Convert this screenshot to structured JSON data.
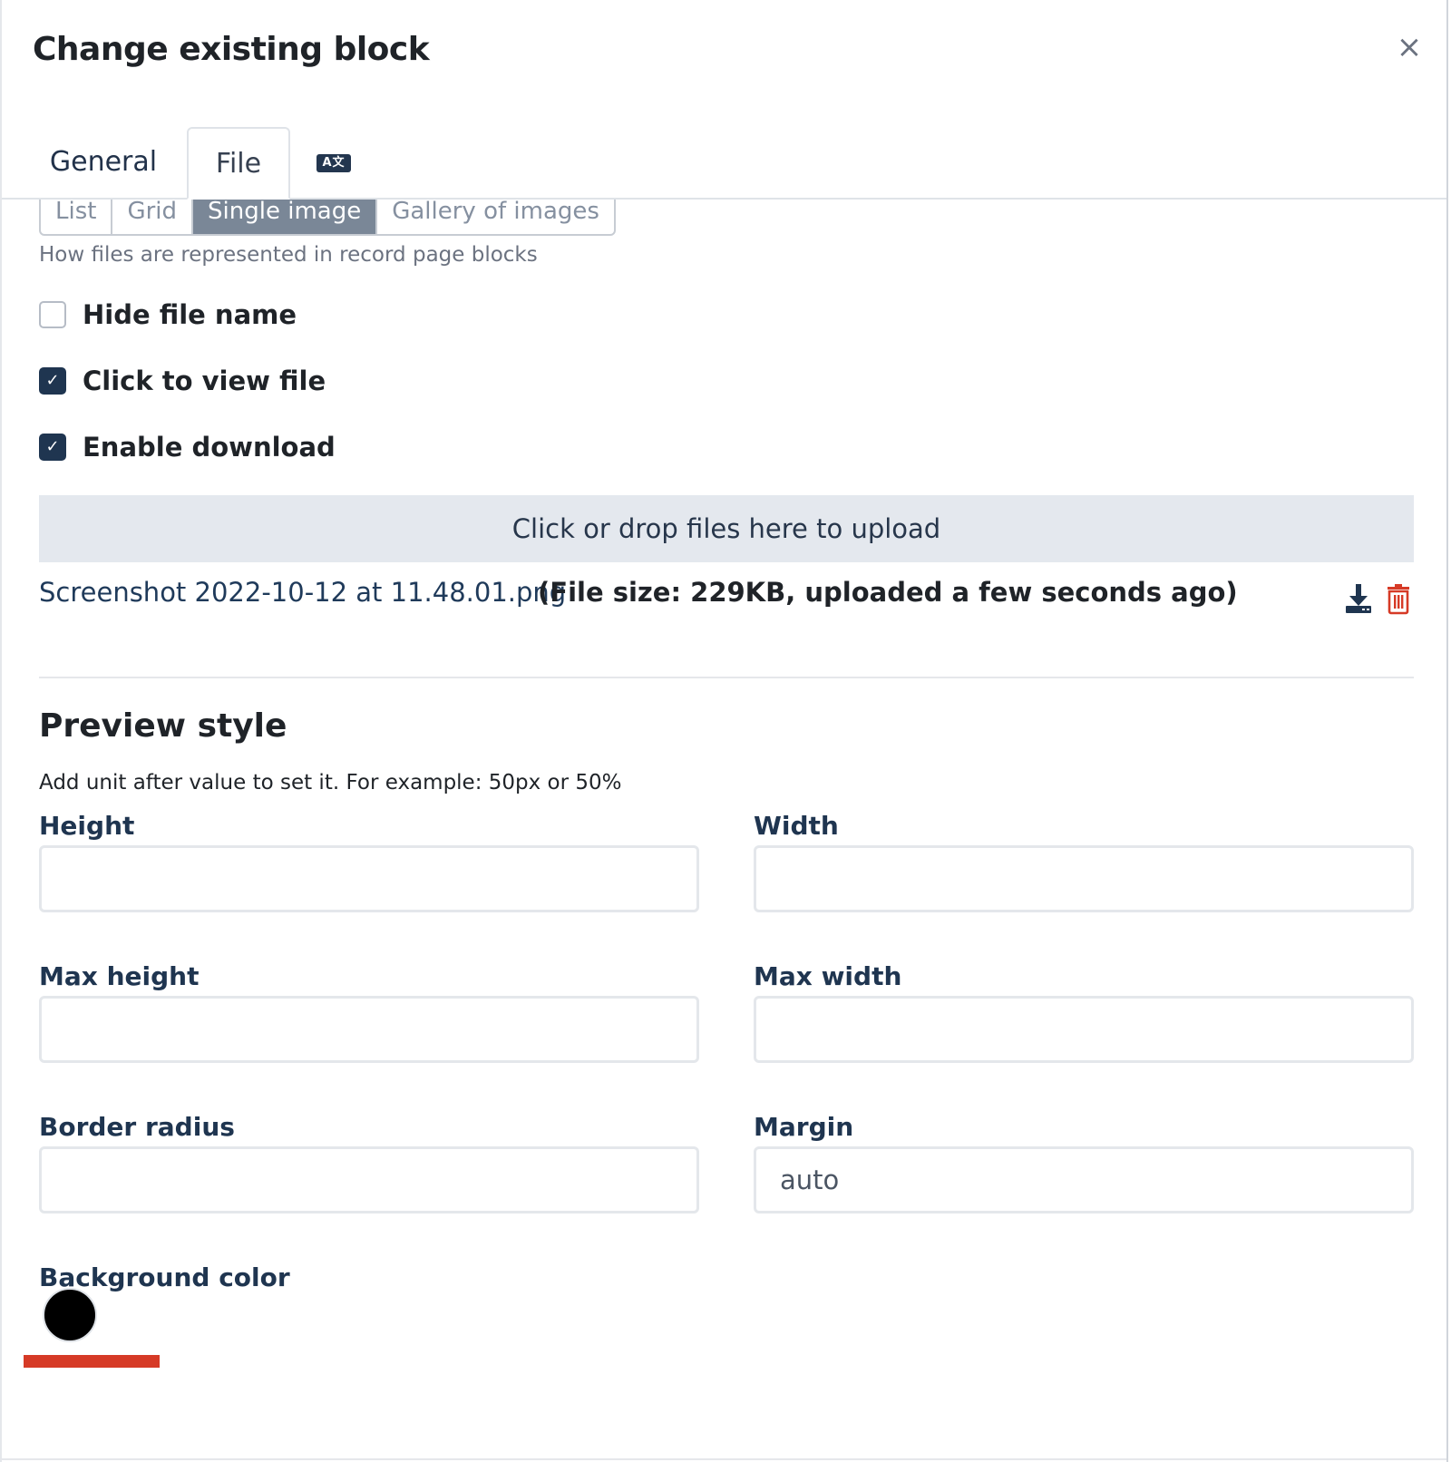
{
  "modal": {
    "title": "Change existing block",
    "close_glyph": "×"
  },
  "tabs": {
    "general": "General",
    "file": "File",
    "translate_icon_text": "A文"
  },
  "representation": {
    "options": [
      "List",
      "Grid",
      "Single image",
      "Gallery of images"
    ],
    "selected": "Single image",
    "helper": "How files are represented in record page blocks"
  },
  "checkboxes": {
    "hide_file_name": {
      "label": "Hide file name",
      "checked": false
    },
    "click_to_view": {
      "label": "Click to view file",
      "checked": true
    },
    "enable_download": {
      "label": "Enable download",
      "checked": true
    }
  },
  "upload": {
    "dropzone_label": "Click or drop files here to upload",
    "file_name": "Screenshot 2022-10-12 at 11.48.01.png",
    "file_meta": "(File size: 229KB, uploaded a few seconds ago)",
    "download_icon": "download-icon",
    "delete_icon": "trash-icon"
  },
  "preview": {
    "title": "Preview style",
    "help": "Add unit after value to set it. For example: 50px or 50%",
    "height_label": "Height",
    "height_value": "",
    "width_label": "Width",
    "width_value": "",
    "max_height_label": "Max height",
    "max_height_value": "",
    "max_width_label": "Max width",
    "max_width_value": "",
    "border_radius_label": "Border radius",
    "border_radius_value": "",
    "margin_label": "Margin",
    "margin_value": "auto",
    "bg_color_label": "Background color",
    "bg_color_value": "#000000"
  },
  "colors": {
    "primary": "#1f3550",
    "danger": "#d63a26",
    "segment_active": "#7a8797"
  }
}
